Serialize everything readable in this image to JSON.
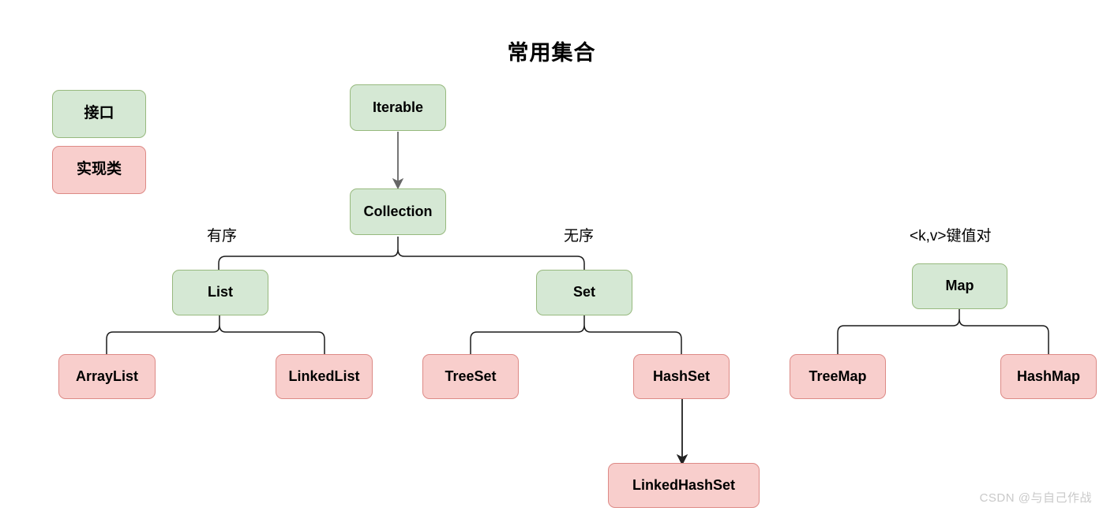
{
  "title": "常用集合",
  "legend": {
    "interface": {
      "label": "接口",
      "color": "#d5e8d4",
      "border": "#97b97e"
    },
    "implementation": {
      "label": "实现类",
      "color": "#f8cecc",
      "border": "#dd8a86"
    }
  },
  "nodes": {
    "iterable": "Iterable",
    "collection": "Collection",
    "list": "List",
    "set": "Set",
    "map": "Map",
    "arraylist": "ArrayList",
    "linkedlist": "LinkedList",
    "treeset": "TreeSet",
    "hashset": "HashSet",
    "linkedhashset": "LinkedHashSet",
    "treemap": "TreeMap",
    "hashmap": "HashMap"
  },
  "edge_labels": {
    "ordered": "有序",
    "unordered": "无序",
    "keyvalue": "<k,v>键值对"
  },
  "watermark": "CSDN @与自己作战",
  "colors": {
    "arrow": "#666666",
    "brace": "#1a1a1a",
    "background": "#ffffff"
  }
}
